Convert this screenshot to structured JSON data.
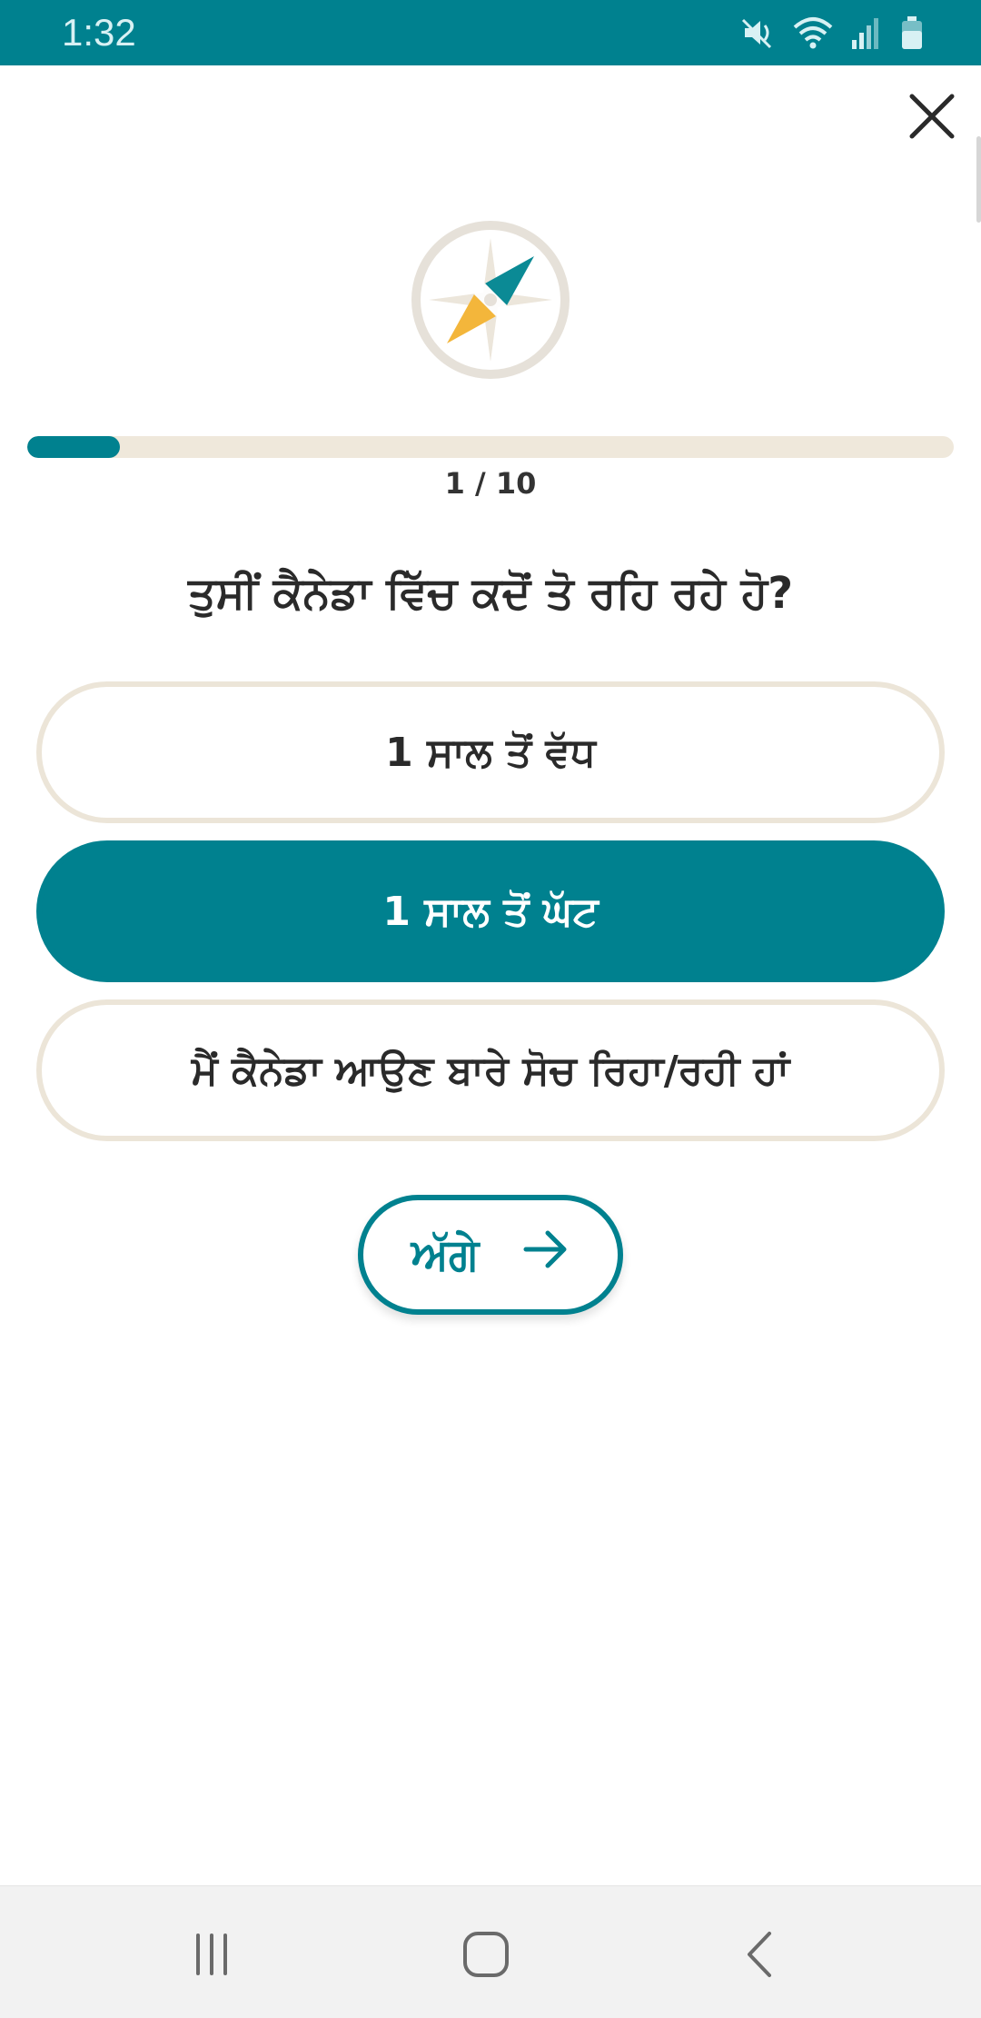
{
  "status_bar": {
    "time": "1:32",
    "icons": [
      "mute-icon",
      "wifi-icon",
      "signal-icon",
      "battery-icon"
    ],
    "bg_color": "#00818f"
  },
  "header": {
    "close_icon": "close-icon"
  },
  "progress": {
    "current": 1,
    "total": 10,
    "label": "1 / 10",
    "fraction": 0.1
  },
  "question": {
    "text": "ਤੁਸੀਂ ਕੈਨੇਡਾ ਵਿੱਚ ਕਦੋਂ ਤੋ ਰਹਿ ਰਹੇ ਹੋ?"
  },
  "options": [
    {
      "label": "1 ਸਾਲ ਤੋਂ ਵੱਧ",
      "selected": false
    },
    {
      "label": "1 ਸਾਲ ਤੋਂ ਘੱਟ",
      "selected": true
    },
    {
      "label": "ਮੈਂ ਕੈਨੇਡਾ ਆਉਣ ਬਾਰੇ ਸੋਚ ਰਿਹਾ/ਰਹੀ ਹਾਂ",
      "selected": false
    }
  ],
  "next_button": {
    "label": "ਅੱਗੇ",
    "icon": "arrow-right-icon"
  },
  "nav_bar": {
    "items": [
      "recent-apps-icon",
      "home-icon",
      "back-icon"
    ]
  },
  "colors": {
    "accent": "#00818f",
    "option_border": "#ece5d8",
    "compass_yellow": "#f3b63b",
    "compass_ring": "#e6e1d9"
  }
}
